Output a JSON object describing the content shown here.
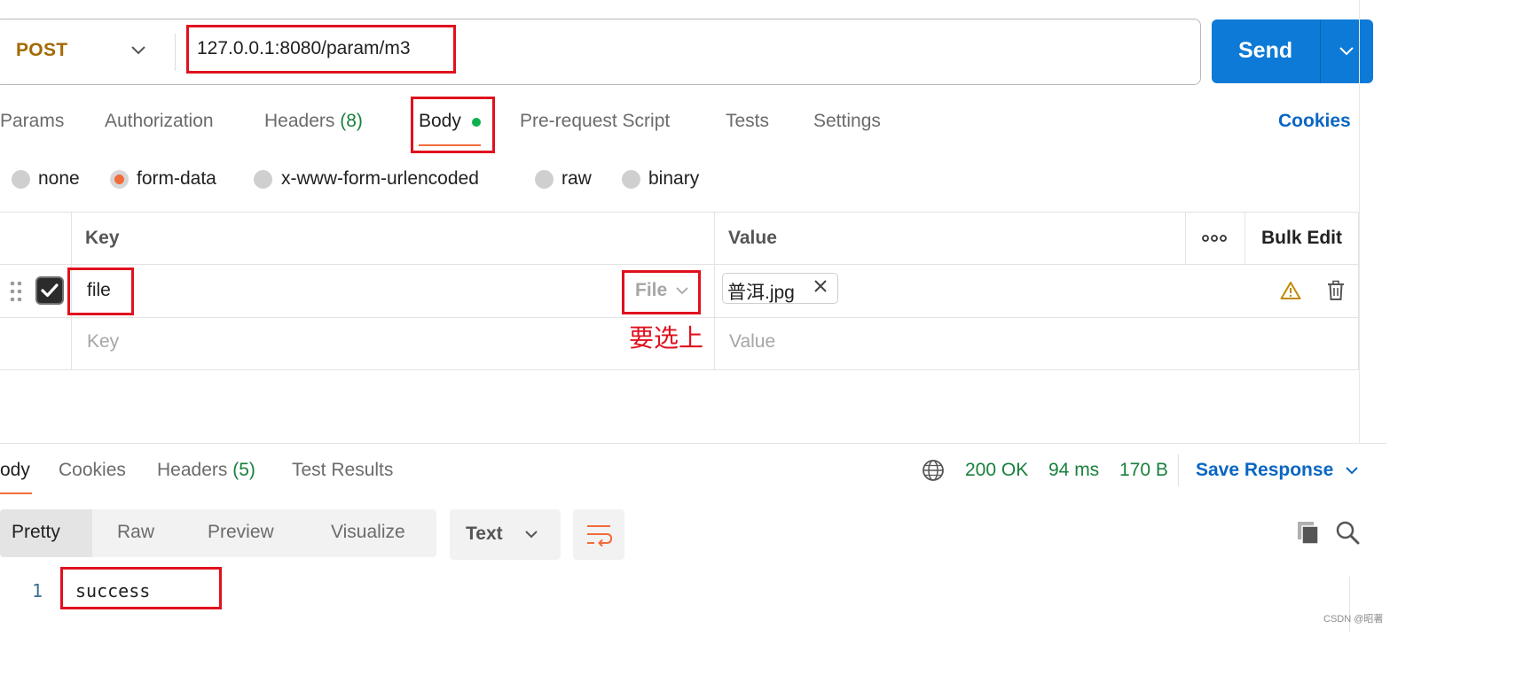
{
  "request": {
    "method": "POST",
    "url": "127.0.0.1:8080/param/m3",
    "send_label": "Send"
  },
  "request_tabs": [
    {
      "label": "Params",
      "count": ""
    },
    {
      "label": "Authorization",
      "count": ""
    },
    {
      "label": "Headers",
      "count": "(8)"
    },
    {
      "label": "Body",
      "count": ""
    },
    {
      "label": "Pre-request Script",
      "count": ""
    },
    {
      "label": "Tests",
      "count": ""
    },
    {
      "label": "Settings",
      "count": ""
    }
  ],
  "cookies_label": "Cookies",
  "body_types": [
    {
      "label": "none",
      "selected": false
    },
    {
      "label": "form-data",
      "selected": true
    },
    {
      "label": "x-www-form-urlencoded",
      "selected": false
    },
    {
      "label": "raw",
      "selected": false
    },
    {
      "label": "binary",
      "selected": false
    }
  ],
  "params_table": {
    "headers": {
      "key": "Key",
      "value": "Value",
      "bulk_edit": "Bulk Edit"
    },
    "rows": [
      {
        "key": "file",
        "type": "File",
        "value": "普洱.jpg",
        "enabled": true
      }
    ],
    "key_placeholder": "Key",
    "value_placeholder": "Value"
  },
  "annotation_text": "要选上",
  "response": {
    "tabs": [
      {
        "label": "Body",
        "visible_text": "ody",
        "count": ""
      },
      {
        "label": "Cookies",
        "count": ""
      },
      {
        "label": "Headers",
        "count": "(5)"
      },
      {
        "label": "Test Results",
        "count": ""
      }
    ],
    "status": "200 OK",
    "time": "94 ms",
    "size": "170 B",
    "save_label": "Save Response",
    "formats": [
      "Pretty",
      "Raw",
      "Preview",
      "Visualize"
    ],
    "active_format": "Pretty",
    "language": "Text",
    "lines": [
      {
        "number": "1",
        "text": "success"
      }
    ]
  },
  "watermark": "CSDN @昭著",
  "colors": {
    "accent": "#f26b3a",
    "send_blue": "#0d7ad7",
    "link_blue": "#0a66c2",
    "status_green": "#19803e",
    "method_orange": "#a36a05",
    "annotation_red": "#e0111e"
  }
}
